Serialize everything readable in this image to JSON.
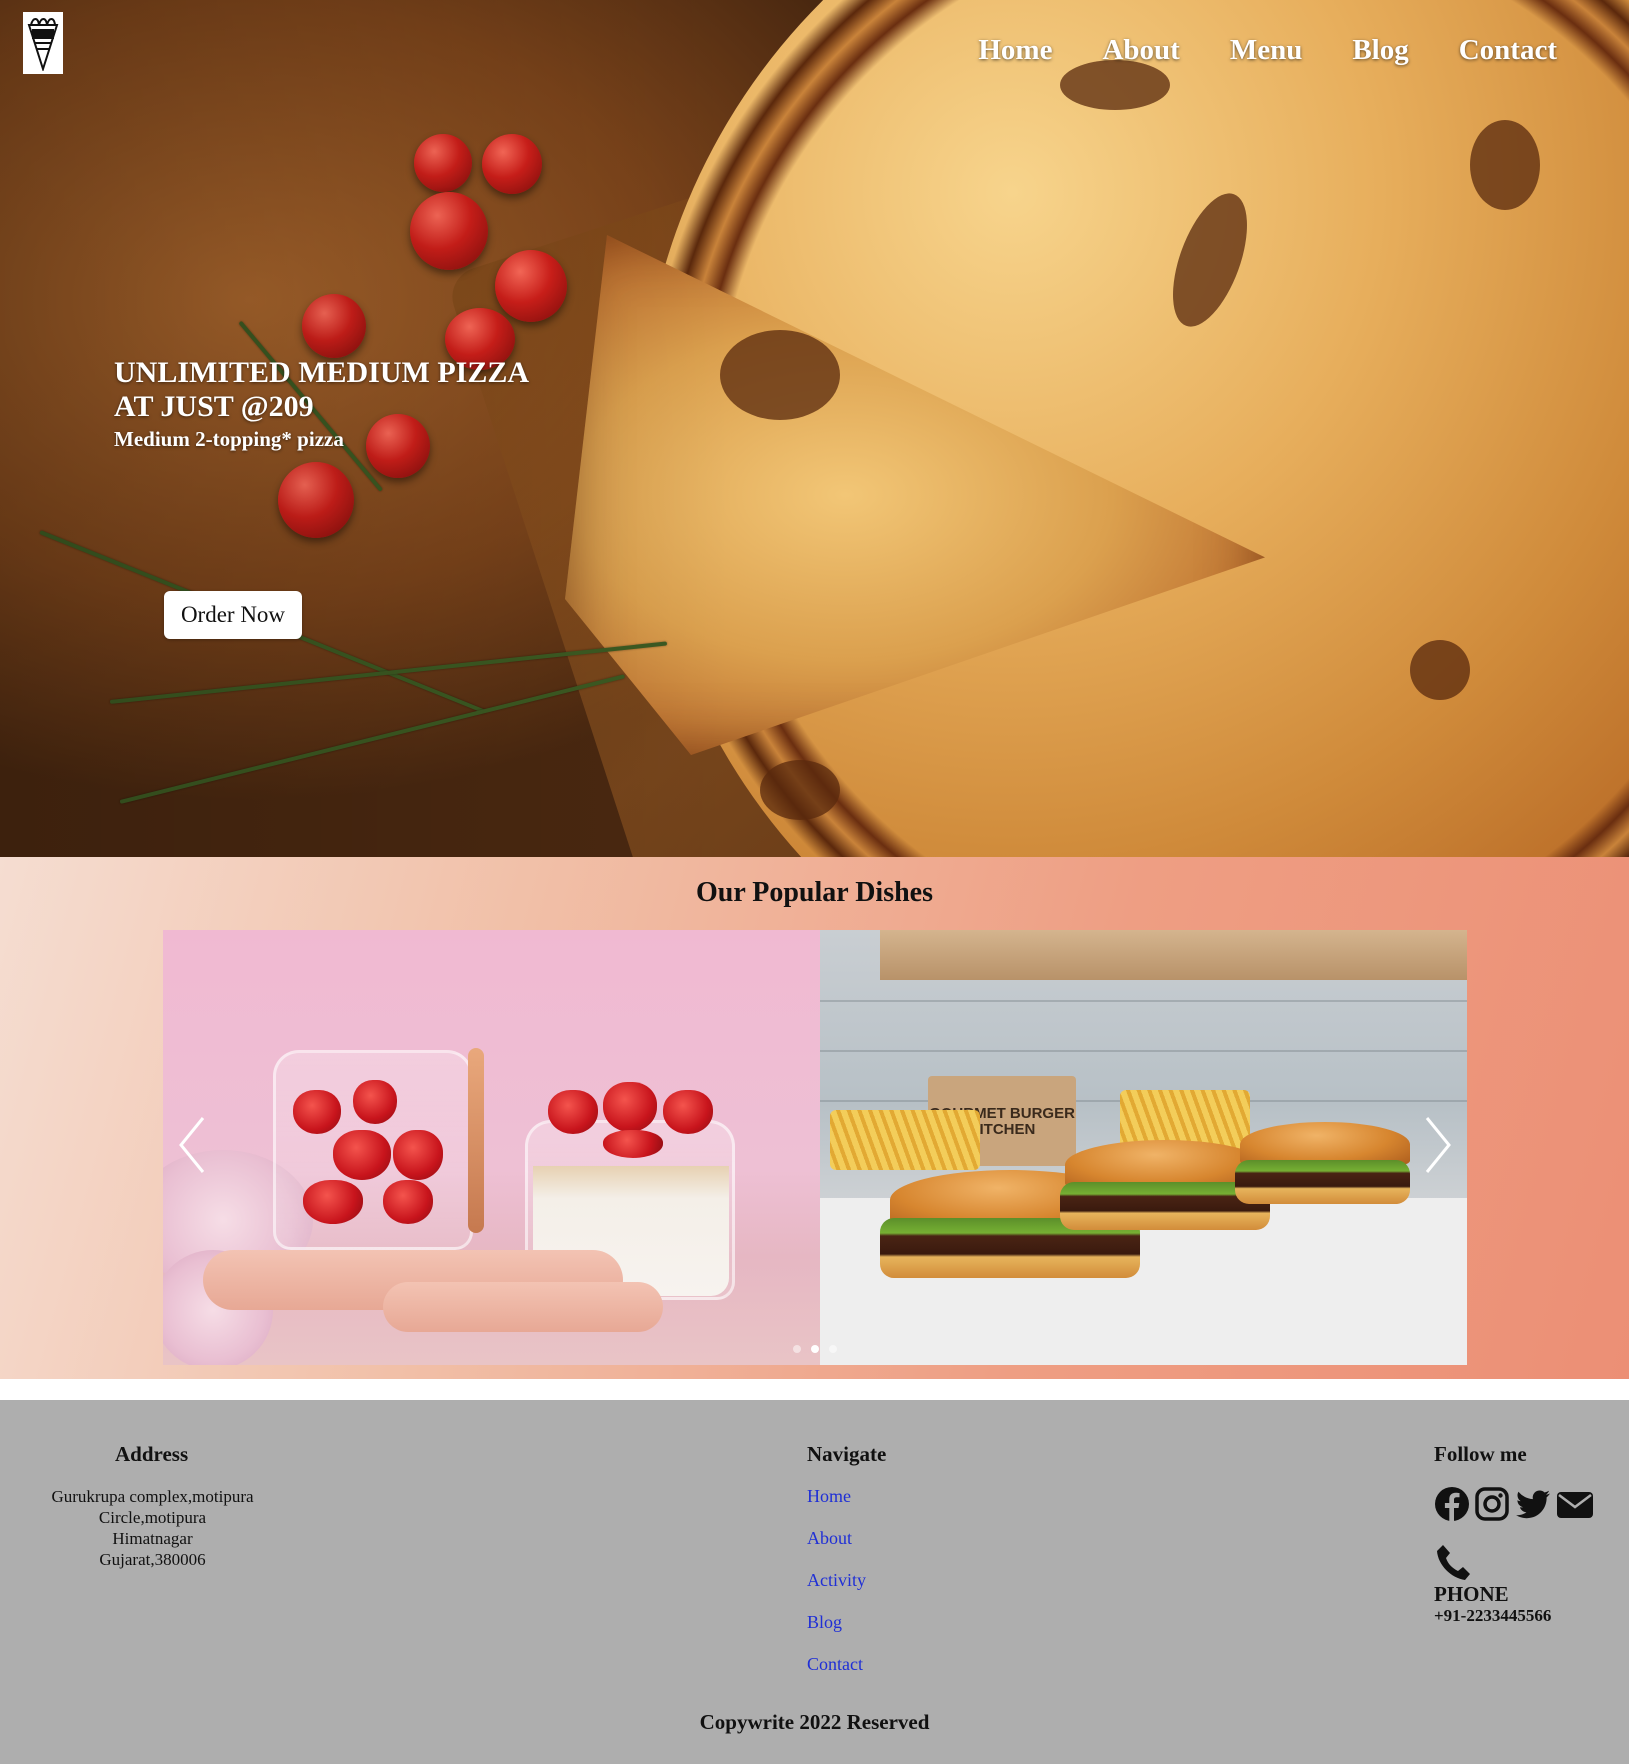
{
  "header": {
    "logo_icon": "brand-logo-icon",
    "nav": [
      {
        "label": "Home"
      },
      {
        "label": "About"
      },
      {
        "label": "Menu"
      },
      {
        "label": "Blog"
      },
      {
        "label": "Contact"
      }
    ]
  },
  "hero": {
    "headline": "UNLIMITED MEDIUM PIZZA AT JUST @209",
    "subheadline": "Medium 2-topping* pizza",
    "cta_label": "Order Now"
  },
  "popular": {
    "title": "Our Popular Dishes",
    "slides": [
      {
        "icon": "strawberry-dessert-jars-image"
      },
      {
        "icon": "burgers-and-fries-image",
        "box_text": "GOURMET BURGER KITCHEN"
      }
    ],
    "prev_icon": "chevron-left-icon",
    "next_icon": "chevron-right-icon",
    "indicator_count": 3,
    "active_indicator": 2
  },
  "footer": {
    "address": {
      "title": "Address",
      "lines": [
        "Gurukrupa complex,motipura",
        "Circle,motipura",
        "Himatnagar",
        "Gujarat,380006"
      ]
    },
    "navigate": {
      "title": "Navigate",
      "links": [
        {
          "label": "Home"
        },
        {
          "label": "About"
        },
        {
          "label": "Activity"
        },
        {
          "label": "Blog"
        },
        {
          "label": "Contact"
        }
      ]
    },
    "follow": {
      "title": "Follow me",
      "icons": [
        "facebook-icon",
        "instagram-icon",
        "twitter-icon",
        "email-icon"
      ],
      "phone_icon": "phone-icon",
      "phone_label": "PHONE",
      "phone_number": "+91-2233445566"
    },
    "copyright": "Copywrite 2022 Reserved"
  },
  "colors": {
    "link_blue": "#1f2fd6",
    "footer_bg": "#aeaeae",
    "popular_gradient_start": "#f5ddd1",
    "popular_gradient_end": "#ec8f75"
  }
}
